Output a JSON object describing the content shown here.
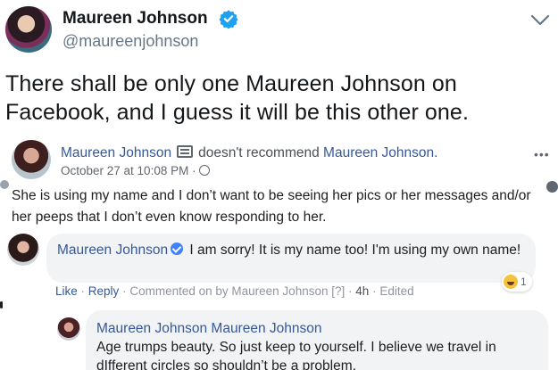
{
  "tweet": {
    "name": "Maureen Johnson",
    "handle": "@maureenjohnson",
    "text": "There shall be only one Maureen Johnson on Facebook, and I guess it will be this other one.",
    "icons": {
      "verified": "verified-badge-icon",
      "menu": "chevron-down-icon"
    },
    "colors": {
      "verified": "#1da1f2"
    }
  },
  "fb_post": {
    "author": "Maureen Johnson",
    "action": "doesn't recommend",
    "target": "Maureen Johnson.",
    "timestamp": "October 27 at 10:08 PM",
    "separator": "·",
    "more": "•••",
    "text": "She is using my name and I don’t want to be seeing her pics or her messages and/or her peeps that I don’t even know responding to her."
  },
  "comment": {
    "author": "Maureen Johnson",
    "text": "I am sorry! It is my name too! I'm using my own name!",
    "like": "Like",
    "reply": "Reply",
    "dot": "·",
    "commented_on_by": "Commented on by Maureen Johnson",
    "help": "[?]",
    "time": "4h",
    "edited": "Edited",
    "reaction_count": "1"
  },
  "reply": {
    "author": "Maureen Johnson",
    "tag": "Maureen Johnson",
    "text": "Age trumps beauty. So just keep to yourself. I believe we travel in dIfferent circles so shouldn’t be a problem."
  },
  "colors": {
    "fb_link": "#365899",
    "bubble": "#f2f3f5"
  }
}
